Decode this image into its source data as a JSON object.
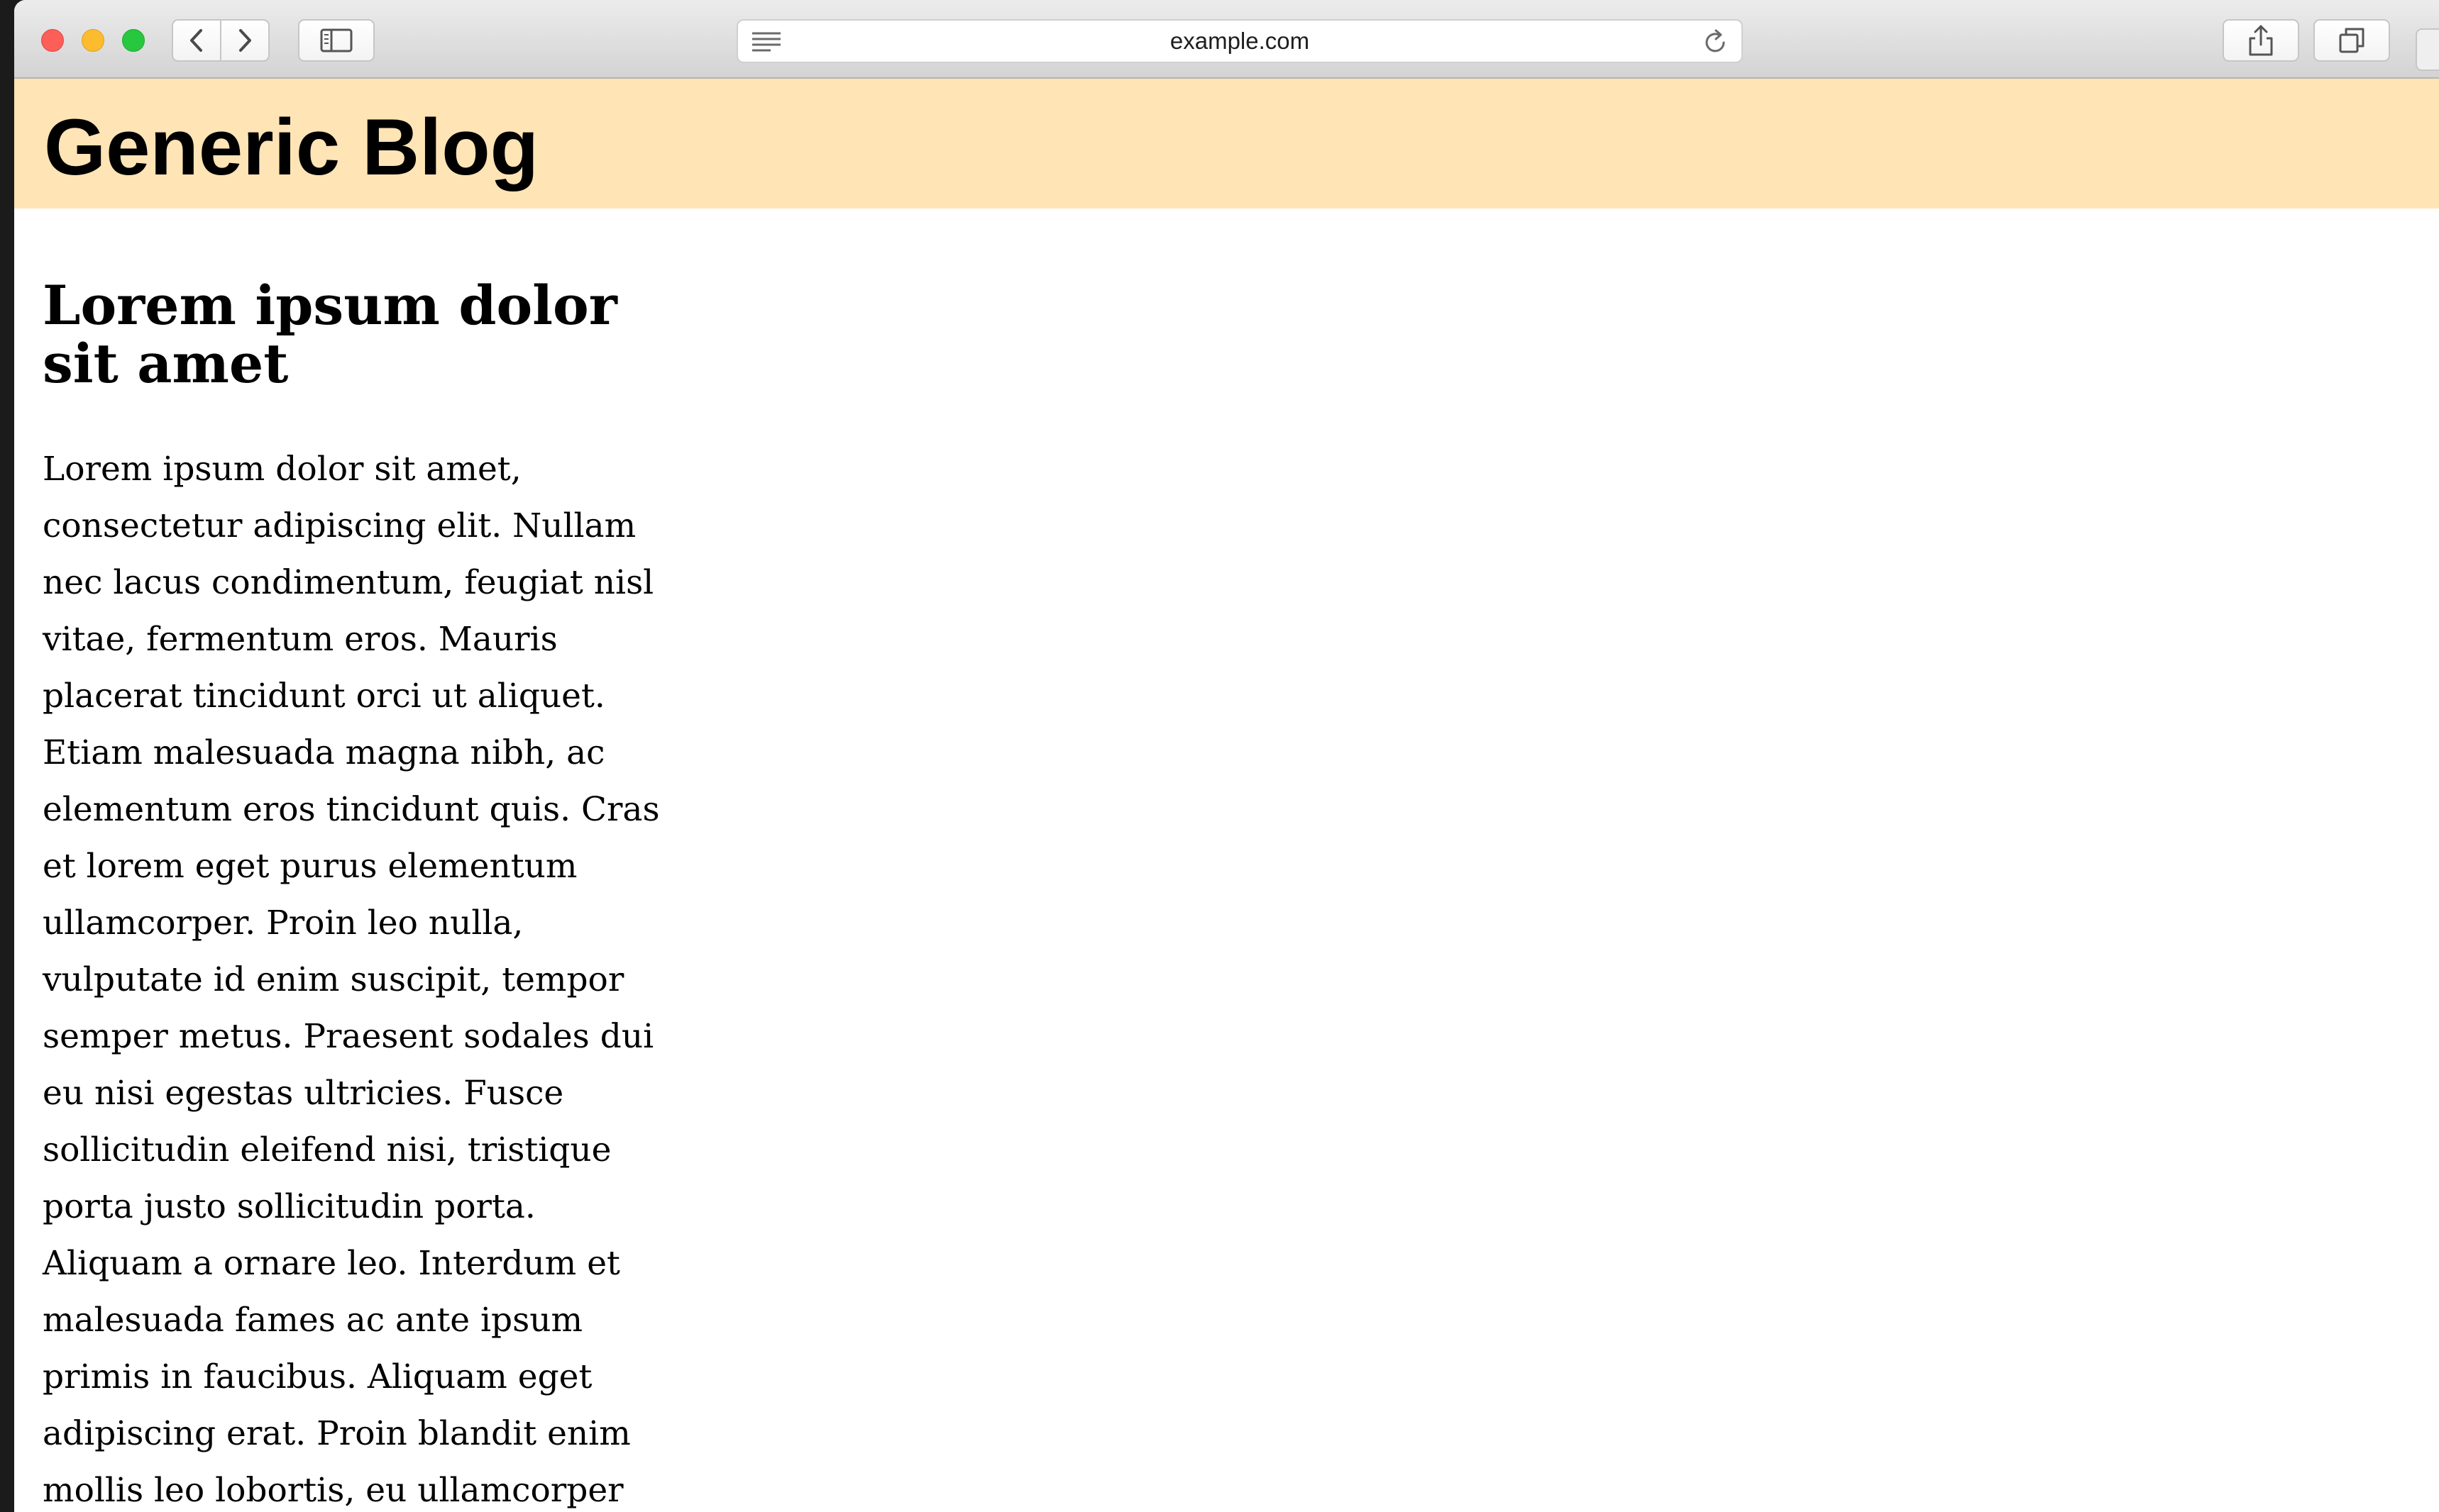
{
  "browser": {
    "url": "example.com"
  },
  "header": {
    "title": "Generic Blog"
  },
  "post": {
    "title": "Lorem ipsum dolor sit amet",
    "body": "Lorem ipsum dolor sit amet, consectetur adipiscing elit. Nullam nec lacus condimentum, feugiat nisl vitae, fermentum eros. Mauris placerat tincidunt orci ut aliquet. Etiam malesuada magna nibh, ac elementum eros tincidunt quis. Cras et lorem eget purus elementum ullamcorper. Proin leo nulla, vulputate id enim suscipit, tempor semper metus. Praesent sodales dui eu nisi egestas ultricies. Fusce sollicitudin eleifend nisi, tristique porta justo sollicitudin porta. Aliquam a ornare leo. Interdum et malesuada fames ac ante ipsum primis in faucibus. Aliquam eget adipiscing erat. Proin blandit enim mollis leo lobortis, eu ullamcorper"
  },
  "colors": {
    "header_background": "#ffe4b6",
    "close": "#fc5f57",
    "minimize": "#fdbc2e",
    "maximize": "#27c840"
  },
  "icons": {
    "back": "chevron-left-icon",
    "forward": "chevron-right-icon",
    "sidebar": "sidebar-icon",
    "reader": "reader-lines-icon",
    "reload": "reload-icon",
    "share": "share-icon",
    "tabs": "tabs-icon"
  }
}
